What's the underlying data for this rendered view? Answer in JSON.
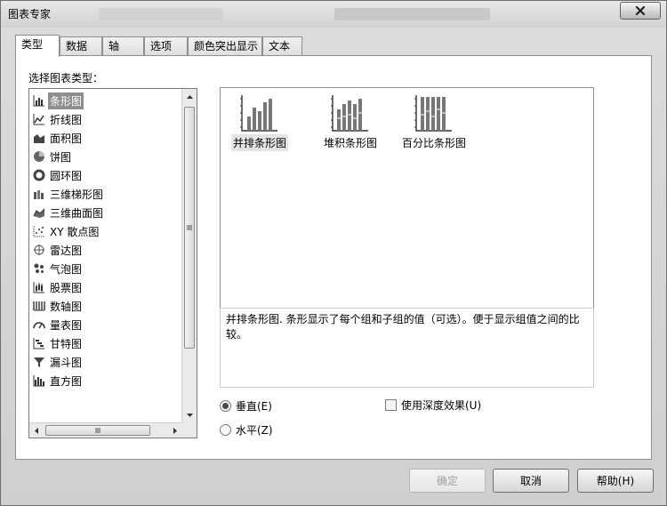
{
  "window": {
    "title": "图表专家"
  },
  "tabs": [
    {
      "label": "类型",
      "active": true
    },
    {
      "label": "数据"
    },
    {
      "label": "轴"
    },
    {
      "label": "选项"
    },
    {
      "label": "颜色突出显示"
    },
    {
      "label": "文本"
    }
  ],
  "chart_types": {
    "label": "选择图表类型：",
    "items": [
      {
        "label": "条形图",
        "icon": "bar-chart-icon",
        "selected": true
      },
      {
        "label": "折线图",
        "icon": "line-chart-icon"
      },
      {
        "label": "面积图",
        "icon": "area-chart-icon"
      },
      {
        "label": "饼图",
        "icon": "pie-chart-icon"
      },
      {
        "label": "圆环图",
        "icon": "doughnut-chart-icon"
      },
      {
        "label": "三维梯形图",
        "icon": "3d-step-chart-icon"
      },
      {
        "label": "三维曲面图",
        "icon": "3d-surface-chart-icon"
      },
      {
        "label": "XY 散点图",
        "icon": "scatter-chart-icon"
      },
      {
        "label": "雷达图",
        "icon": "radar-chart-icon"
      },
      {
        "label": "气泡图",
        "icon": "bubble-chart-icon"
      },
      {
        "label": "股票图",
        "icon": "stock-chart-icon"
      },
      {
        "label": "数轴图",
        "icon": "number-axis-chart-icon"
      },
      {
        "label": "量表图",
        "icon": "gauge-chart-icon"
      },
      {
        "label": "甘特图",
        "icon": "gantt-chart-icon"
      },
      {
        "label": "漏斗图",
        "icon": "funnel-chart-icon"
      },
      {
        "label": "直方图",
        "icon": "histogram-chart-icon"
      }
    ]
  },
  "subtypes": [
    {
      "label": "并排条形图",
      "selected": true
    },
    {
      "label": "堆积条形图"
    },
    {
      "label": "百分比条形图"
    }
  ],
  "description": "并排条形图. 条形显示了每个组和子组的值（可选）。便于显示组值之间的比较。",
  "orientation": {
    "vertical": {
      "label": "垂直(E)",
      "checked": true
    },
    "horizontal": {
      "label": "水平(Z)",
      "checked": false
    }
  },
  "depth_effect": {
    "label": "使用深度效果(U)",
    "checked": false
  },
  "buttons": {
    "ok": "确定",
    "cancel": "取消",
    "help": "帮助(H)"
  },
  "colors": {
    "selection": "#8e8e8e",
    "dialog_bg": "#d6d6d6"
  }
}
